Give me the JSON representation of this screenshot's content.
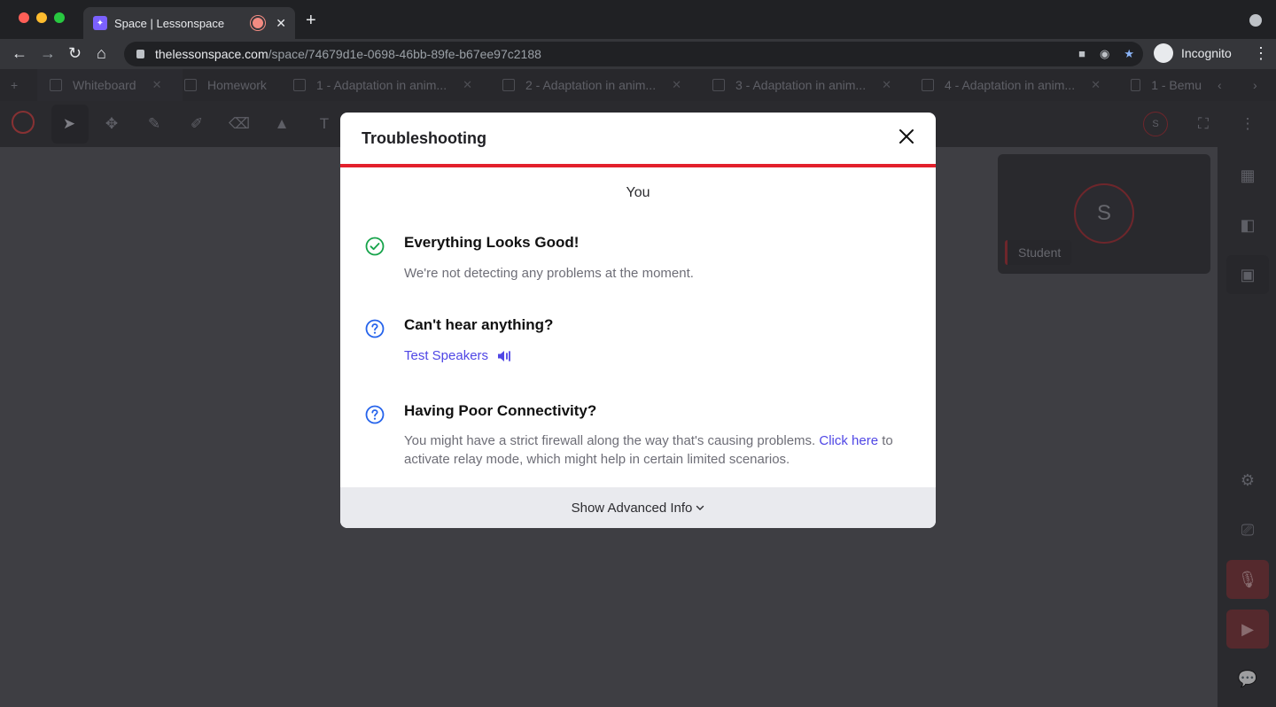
{
  "browser": {
    "tab_title": "Space | Lessonspace",
    "url_host": "thelessonspace.com",
    "url_path": "/space/74679d1e-0698-46bb-89fe-b67ee97c2188",
    "profile_label": "Incognito"
  },
  "lessonspace_tabs": [
    {
      "label": "Whiteboard"
    },
    {
      "label": "Homework"
    },
    {
      "label": "1 - Adaptation in anim..."
    },
    {
      "label": "2 - Adaptation in anim..."
    },
    {
      "label": "3 - Adaptation in anim..."
    },
    {
      "label": "4 - Adaptation in anim..."
    },
    {
      "label": "1 - Bemu"
    }
  ],
  "participant": {
    "initial": "S",
    "name": "Student"
  },
  "toolbar_avatar_initial": "S",
  "modal": {
    "title": "Troubleshooting",
    "section": "You",
    "items": [
      {
        "title": "Everything Looks Good!",
        "text": "We're not detecting any problems at the moment."
      },
      {
        "title": "Can't hear anything?",
        "action": "Test Speakers"
      },
      {
        "title": "Having Poor Connectivity?",
        "text_before": "You might have a strict firewall along the way that's causing problems. ",
        "link": "Click here",
        "text_after": " to activate relay mode, which might help in certain limited scenarios."
      }
    ],
    "footer": "Show Advanced Info"
  },
  "colors": {
    "accent_red": "#e3202c",
    "link": "#4f46e5",
    "success": "#16a34a",
    "info": "#2563eb"
  }
}
